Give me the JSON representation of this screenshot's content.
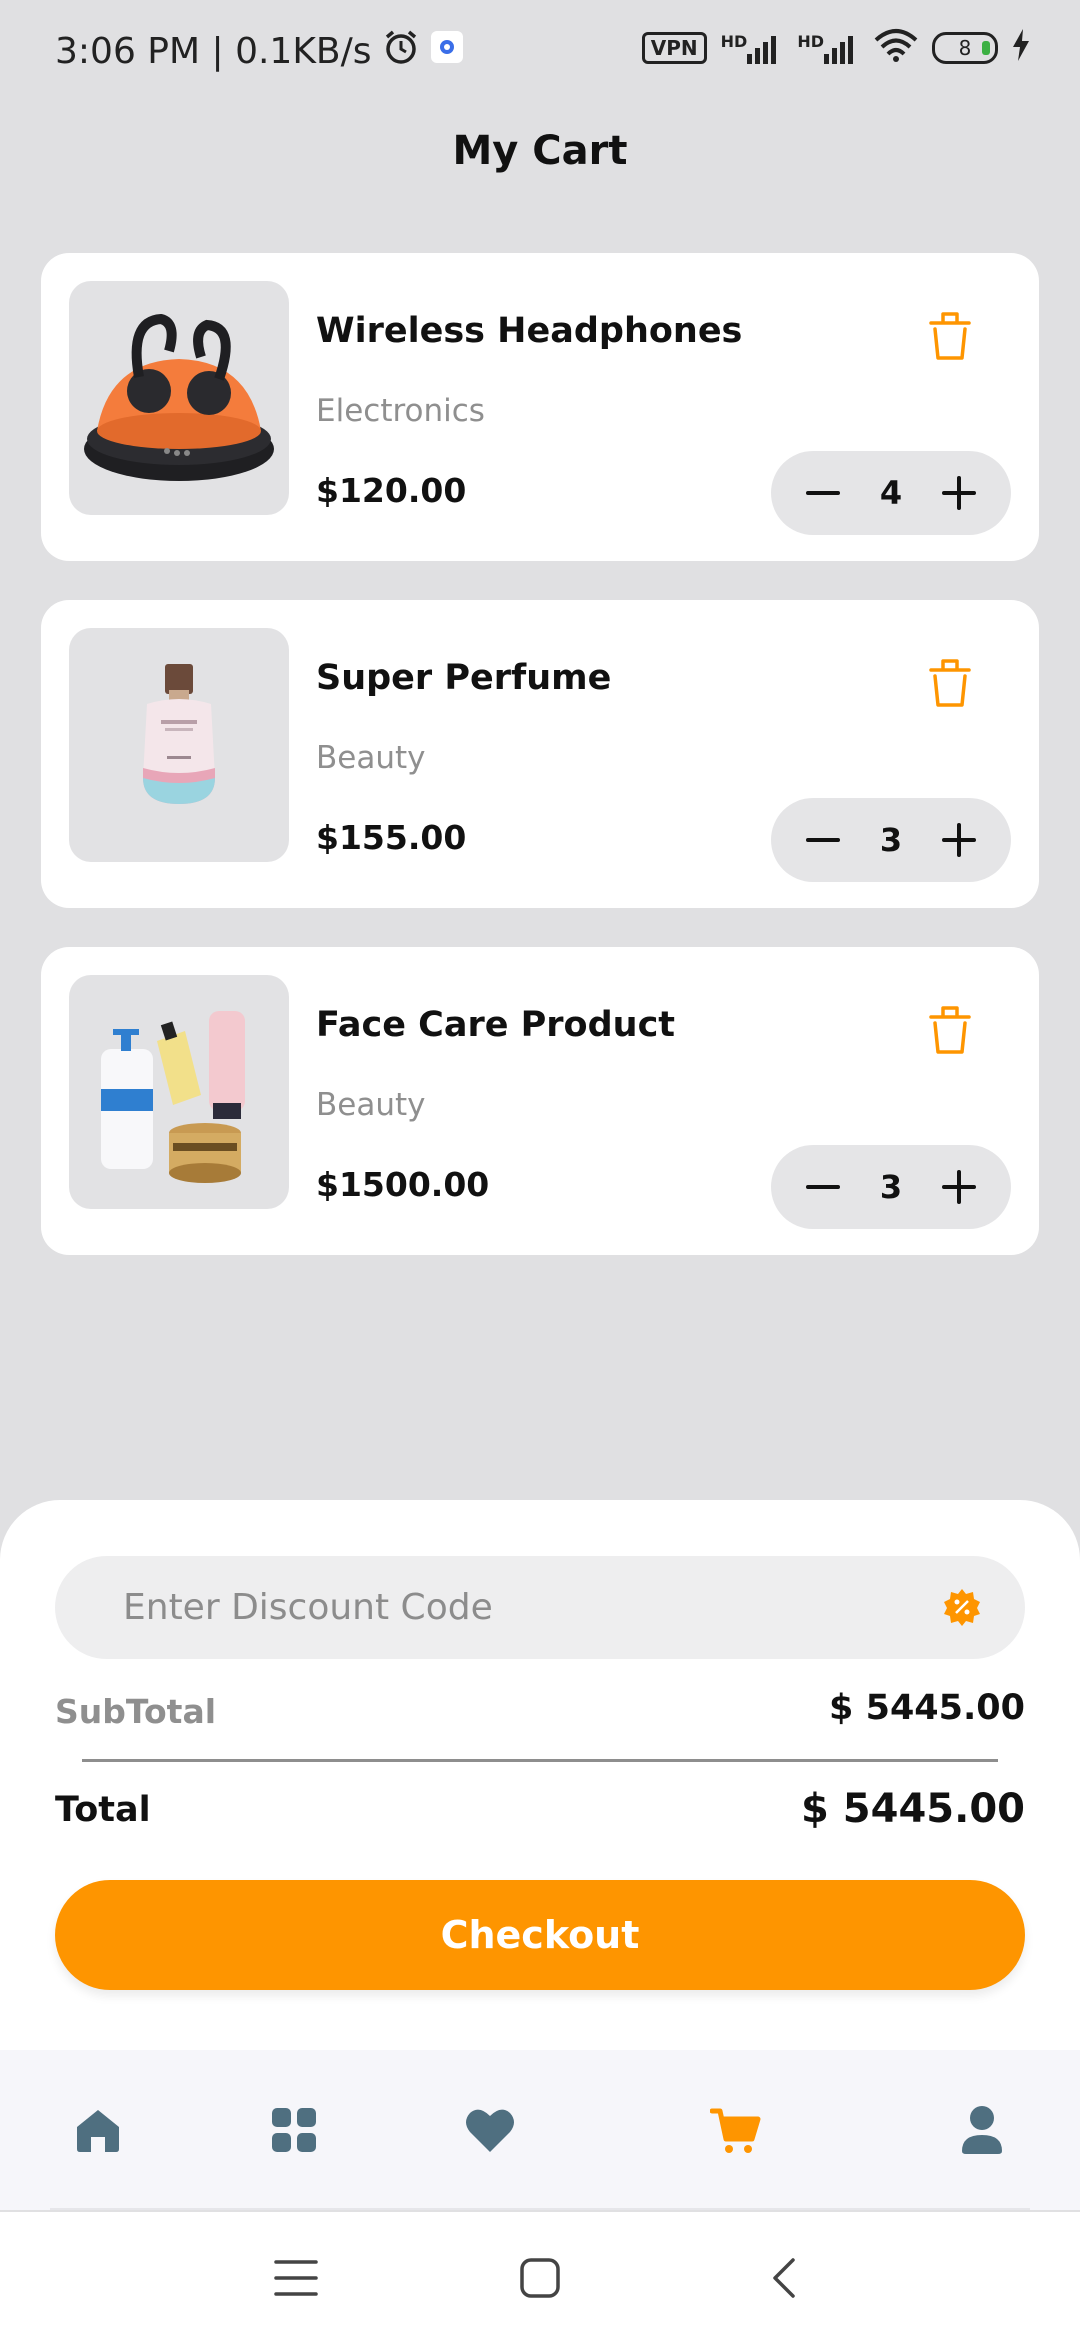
{
  "status_bar": {
    "time_speed": "3:06 PM | 0.1KB/s",
    "vpn": "VPN",
    "hd1": "HD",
    "hd2": "HD",
    "battery": "8"
  },
  "header": {
    "title": "My Cart"
  },
  "cart": {
    "items": [
      {
        "name": "Wireless Headphones",
        "category": "Electronics",
        "price": "$120.00",
        "qty": "4",
        "image": "headphones-image"
      },
      {
        "name": "Super Perfume",
        "category": "Beauty",
        "price": "$155.00",
        "qty": "3",
        "image": "perfume-image"
      },
      {
        "name": "Face Care Product",
        "category": "Beauty",
        "price": "$1500.00",
        "qty": "3",
        "image": "face-care-image"
      }
    ]
  },
  "summary": {
    "discount_placeholder": "Enter Discount Code",
    "subtotal_label": "SubTotal",
    "subtotal_value": "$ 5445.00",
    "total_label": "Total",
    "total_value": "$ 5445.00",
    "checkout_label": "Checkout"
  },
  "nav": {
    "items": [
      {
        "icon": "home-icon",
        "active": false
      },
      {
        "icon": "grid-icon",
        "active": false
      },
      {
        "icon": "heart-icon",
        "active": false
      },
      {
        "icon": "cart-icon",
        "active": true
      },
      {
        "icon": "profile-icon",
        "active": false
      }
    ]
  },
  "colors": {
    "accent": "#fe9500",
    "nav_icon": "#4f6f80",
    "background": "#e0e0e2"
  }
}
